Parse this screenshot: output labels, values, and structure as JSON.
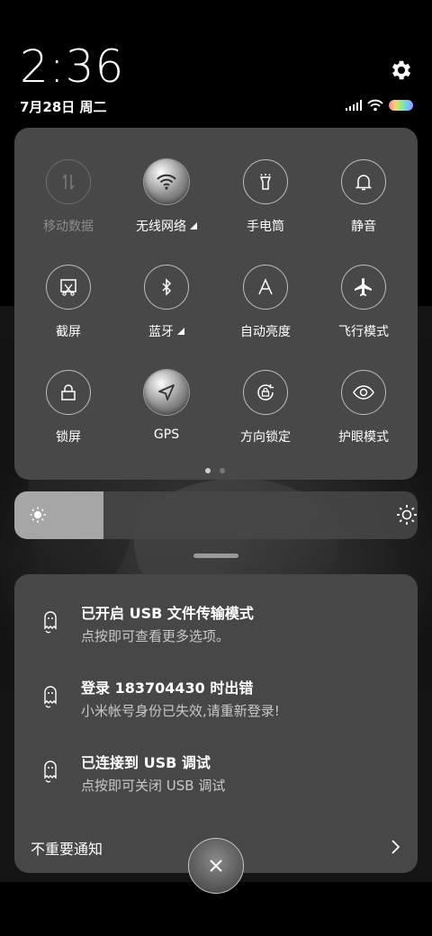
{
  "status": {
    "time": "2:36",
    "date": "7月28日 周二"
  },
  "quick_settings": {
    "tiles": [
      {
        "label": "移动数据",
        "icon": "mobile-data-icon",
        "state": "disabled"
      },
      {
        "label": "无线网络",
        "icon": "wifi-icon",
        "state": "on",
        "expandable": true
      },
      {
        "label": "手电筒",
        "icon": "flashlight-icon",
        "state": "off"
      },
      {
        "label": "静音",
        "icon": "bell-icon",
        "state": "off"
      },
      {
        "label": "截屏",
        "icon": "screenshot-icon",
        "state": "off"
      },
      {
        "label": "蓝牙",
        "icon": "bluetooth-icon",
        "state": "off",
        "expandable": true
      },
      {
        "label": "自动亮度",
        "icon": "auto-brightness-icon",
        "state": "off"
      },
      {
        "label": "飞行模式",
        "icon": "airplane-icon",
        "state": "off"
      },
      {
        "label": "锁屏",
        "icon": "lock-icon",
        "state": "off"
      },
      {
        "label": "GPS",
        "icon": "gps-icon",
        "state": "on"
      },
      {
        "label": "方向锁定",
        "icon": "rotation-lock-icon",
        "state": "off"
      },
      {
        "label": "护眼模式",
        "icon": "eye-icon",
        "state": "off"
      }
    ],
    "page_count": 2,
    "current_page": 1
  },
  "brightness": {
    "level": 0.22
  },
  "notifications": [
    {
      "title": "已开启 USB 文件传输模式",
      "text": "点按即可查看更多选项。",
      "icon": "ghost-icon"
    },
    {
      "title": "登录 183704430 时出错",
      "text": "小米帐号身份已失效,请重新登录!",
      "icon": "ghost-icon"
    },
    {
      "title": "已连接到 USB 调试",
      "text": "点按即可关闭 USB 调试",
      "icon": "ghost-icon"
    }
  ],
  "unimportant_label": "不重要通知",
  "colors": {
    "panel": "#484848",
    "accent_battery": [
      "#ff7b9c",
      "#ffd36e",
      "#8ff08a",
      "#6fc9ff",
      "#b68bff"
    ]
  }
}
